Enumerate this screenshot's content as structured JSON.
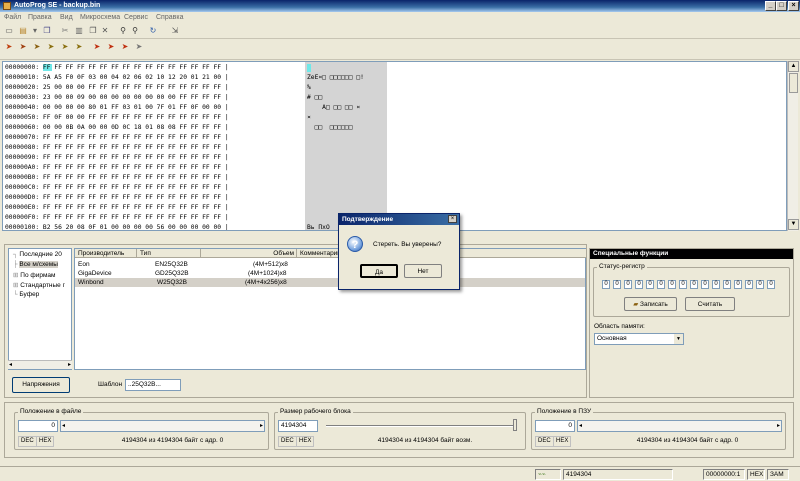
{
  "window": {
    "title": "AutoProg SE - backup.bin"
  },
  "menu": [
    "Файл",
    "Правка",
    "Вид",
    "Микросхема",
    "Сервис",
    "Справка"
  ],
  "toolbar1_icons": [
    "new-icon",
    "open-icon",
    "save-icon",
    "copy-icon",
    "cut-icon",
    "paste-icon",
    "delete-icon",
    "find-icon",
    "find-next-icon",
    "refresh-icon"
  ],
  "toolbar2_icons": [
    "read-icon",
    "write-icon",
    "verify-icon",
    "erase-icon",
    "blank-check-icon",
    "auto-icon",
    "protect-icon",
    "unprotect-icon",
    "id-icon"
  ],
  "hex": {
    "rows": [
      {
        "addr": "00000000:",
        "bytes": "FF FF FF FF FF FF FF FF FF FF FF FF FF FF FF FF",
        "ascii": ""
      },
      {
        "addr": "00000010:",
        "bytes": "5A A5 F0 0F 03 00 04 02 06 02 10 12 20 01 21 00",
        "ascii": "ZеЕ¤□ □□□□□□ □!"
      },
      {
        "addr": "00000020:",
        "bytes": "25 00 00 00 FF FF FF FF FF FF FF FF FF FF FF FF",
        "ascii": "%"
      },
      {
        "addr": "00000030:",
        "bytes": "23 00 00 09 00 00 00 00 00 00 00 00 FF FF FF FF",
        "ascii": "# □□"
      },
      {
        "addr": "00000040:",
        "bytes": "00 00 00 00 80 01 FF 03 01 00 7F 01 FF 0F 00 00",
        "ascii": "    А□ □□ □□ ¤"
      },
      {
        "addr": "00000050:",
        "bytes": "FF 0F 00 00 FF FF FF FF FF FF FF FF FF FF FF FF",
        "ascii": "¤"
      },
      {
        "addr": "00000060:",
        "bytes": "00 00 0B 0A 00 00 0D 0C 18 01 08 08 FF FF FF FF",
        "ascii": "  □□  □□□□□□"
      },
      {
        "addr": "00000070:",
        "bytes": "FF FF FF FF FF FF FF FF FF FF FF FF FF FF FF FF",
        "ascii": ""
      },
      {
        "addr": "00000080:",
        "bytes": "FF FF FF FF FF FF FF FF FF FF FF FF FF FF FF FF",
        "ascii": ""
      },
      {
        "addr": "00000090:",
        "bytes": "FF FF FF FF FF FF FF FF FF FF FF FF FF FF FF FF",
        "ascii": ""
      },
      {
        "addr": "000000A0:",
        "bytes": "FF FF FF FF FF FF FF FF FF FF FF FF FF FF FF FF",
        "ascii": ""
      },
      {
        "addr": "000000B0:",
        "bytes": "FF FF FF FF FF FF FF FF FF FF FF FF FF FF FF FF",
        "ascii": ""
      },
      {
        "addr": "000000C0:",
        "bytes": "FF FF FF FF FF FF FF FF FF FF FF FF FF FF FF FF",
        "ascii": ""
      },
      {
        "addr": "000000D0:",
        "bytes": "FF FF FF FF FF FF FF FF FF FF FF FF FF FF FF FF",
        "ascii": ""
      },
      {
        "addr": "000000E0:",
        "bytes": "FF FF FF FF FF FF FF FF FF FF FF FF FF FF FF FF",
        "ascii": ""
      },
      {
        "addr": "000000F0:",
        "bytes": "FF FF FF FF FF FF FF FF FF FF FF FF FF FF FF FF",
        "ascii": ""
      },
      {
        "addr": "00000100:",
        "bytes": "B2 56 20 08 0F 01 00 00 00 00 56 00 00 00 00 00",
        "ascii": "Вь ПхО"
      }
    ]
  },
  "tree": [
    "Последние 20",
    "Все м/схемы",
    "По фирмам",
    "Стандартные г",
    "Буфер"
  ],
  "chips": {
    "headers": [
      "Производитель",
      "Тип",
      "Объем",
      "Комментарии"
    ],
    "rows": [
      {
        "maker": "Eon",
        "type": "EN25Q32B",
        "size": "(4M+512)x8"
      },
      {
        "maker": "GigaDevice",
        "type": "GD25Q32B",
        "size": "(4M+1024)x8"
      },
      {
        "maker": "Winbond",
        "type": "W25Q32B",
        "size": "(4M+4x256)x8"
      }
    ]
  },
  "voltage_button": "Напряжения",
  "template": {
    "label": "Шаблон",
    "value": "..25Q32B..."
  },
  "special": {
    "title": "Специальные функции",
    "status_group": "Статус-регистр",
    "bits": [
      "0",
      "0",
      "0",
      "0",
      "0",
      "0",
      "0",
      "0",
      "0",
      "0",
      "0",
      "0",
      "0",
      "0",
      "0",
      "0"
    ],
    "write_button": "Записать",
    "read_button": "Считать",
    "memory_label": "Область памяти:",
    "memory_value": "Основная"
  },
  "position_file": {
    "title": "Положение в файле",
    "value": "0",
    "dec": "DEC",
    "hex": "HEX",
    "info": "4194304 из 4194304 байт с адр. 0"
  },
  "block_size": {
    "title": "Размер рабочего блока",
    "value": "4194304",
    "dec": "DEC",
    "hex": "HEX",
    "info": "4194304 из 4194304 байт возм."
  },
  "position_rom": {
    "title": "Положение в ПЗУ",
    "value": "0",
    "dec": "DEC",
    "hex": "HEX",
    "info": "4194304 из 4194304 байт с адр. 0"
  },
  "status": {
    "size": "4194304",
    "offset": "00000000:1",
    "mode": "HEX",
    "ins": "ЗАМ"
  },
  "dialog": {
    "title": "Подтверждение",
    "message": "Стереть. Вы уверены?",
    "yes": "Да",
    "no": "Нет"
  }
}
